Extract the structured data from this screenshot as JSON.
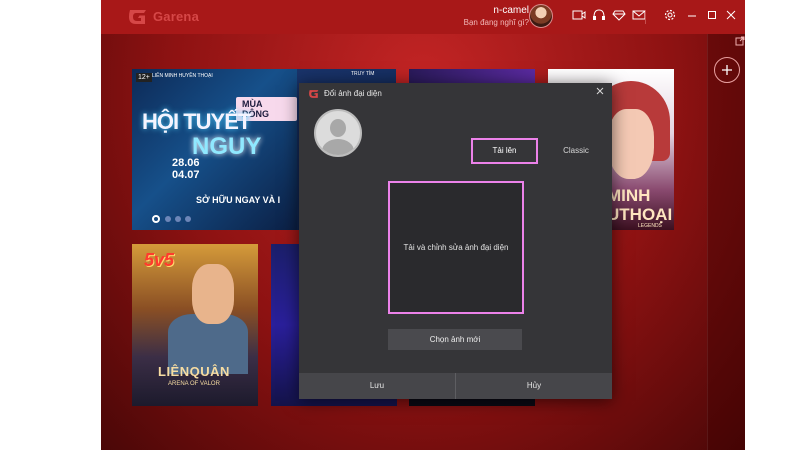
{
  "app": {
    "brand": "Garena",
    "brand_color": "#d64747"
  },
  "user": {
    "name": "n-camel",
    "status": "Bạn đang nghĩ gì?"
  },
  "titlebar_icons": [
    "camera-icon",
    "headset-icon",
    "gem-icon",
    "mail-icon",
    "gear-icon",
    "minimize-icon",
    "maximize-icon",
    "close-icon"
  ],
  "banners": {
    "main": {
      "age": "12+",
      "brand": "LIÊN MINH HUYỀN THOẠI",
      "pill": "MÙA ĐÔNG",
      "headline_1": "HỘI TUYẾT",
      "headline_2": "NGUY",
      "date_1": "28.06",
      "date_2": "04.07",
      "subline": "SỞ HỮU NGAY VÀ I"
    },
    "mid": {
      "small": "TRUY TÌM"
    },
    "right": {
      "line_1": "MINH",
      "line_2": "UTHOẠI",
      "line_3": "LEGENDS"
    }
  },
  "games": {
    "lienquan": {
      "badge": "5v5",
      "title": "LIÊNQUÂN",
      "subtitle": "ARENA OF VALOR"
    }
  },
  "dialog": {
    "title": "Đổi ảnh đại diện",
    "tab_upload": "Tải lên",
    "tab_classic": "Classic",
    "upload_hint": "Tải và chỉnh sửa ảnh đại diện",
    "choose_button": "Chọn ảnh mới",
    "save_button": "Lưu",
    "cancel_button": "Hủy",
    "highlight_color": "#ec82ea"
  }
}
